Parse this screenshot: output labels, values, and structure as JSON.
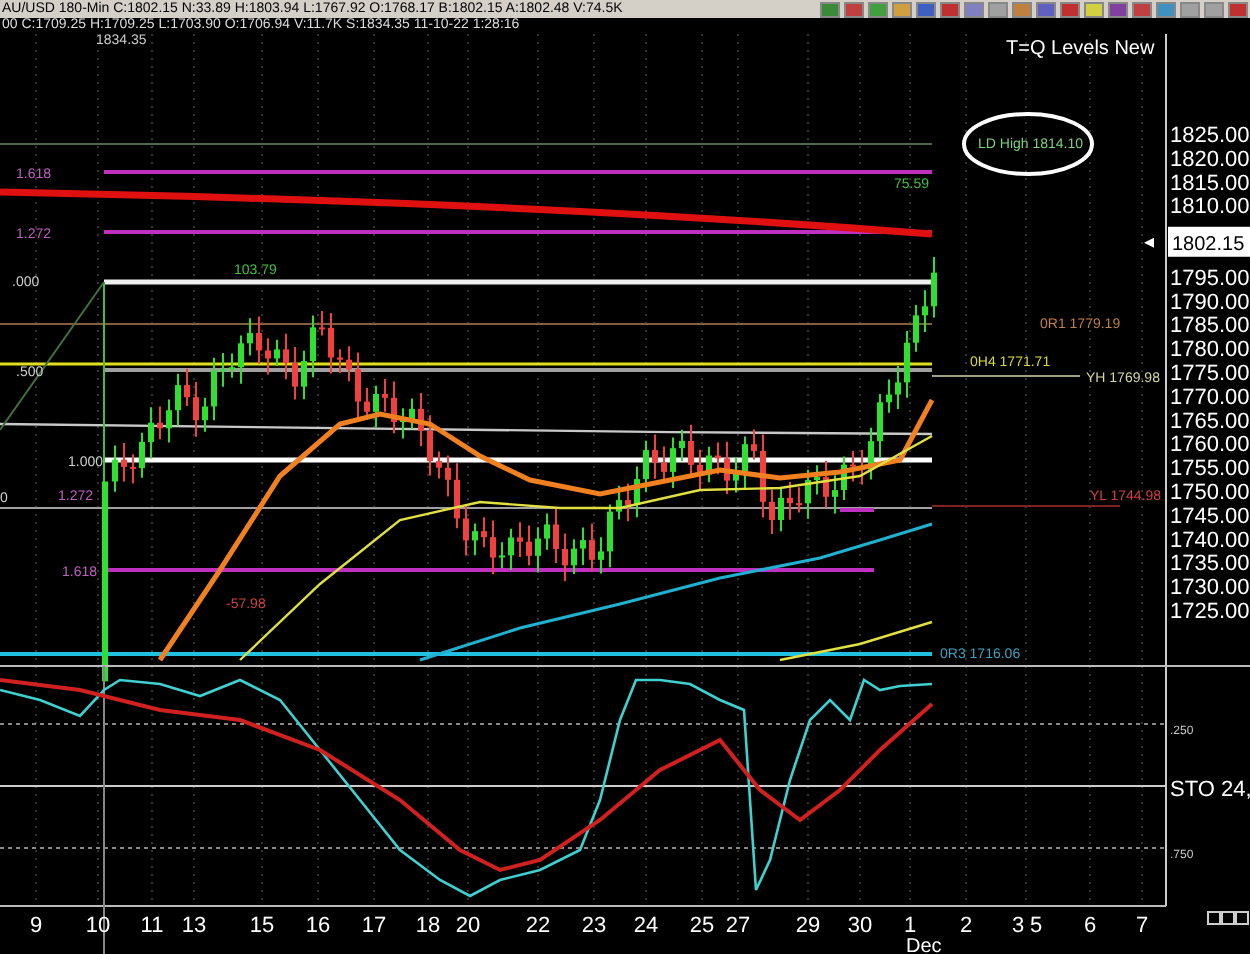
{
  "quote_bar": {
    "text": "AU/USD  180-Min  C:1802.15  N:33.89  H:1803.94  L:1767.92  O:1768.17  B:1802.15  A:1802.48  V:74.5K"
  },
  "cursor_bar": {
    "text": "00  C:1709.25  H:1709.25  L:1703.90  O:1706.94  V:11.7K  S:1834.35  11-10-22  1:28:16"
  },
  "chart": {
    "title": "T=Q Levels New",
    "session_high": "1834.35",
    "annotations": [
      {
        "text": "LD High  1814.10",
        "color": "#7fd07f"
      },
      {
        "text": "1.618",
        "color": "#c060c0"
      },
      {
        "text": "1.272",
        "color": "#c060c0"
      },
      {
        "text": ".000",
        "color": "#d0d0d0"
      },
      {
        "text": "103.79",
        "color": "#40c040"
      },
      {
        "text": ".500",
        "color": "#d0d0d0"
      },
      {
        "text": "1.000",
        "color": "#d0d0d0"
      },
      {
        "text": "0",
        "color": "#d0d0d0"
      },
      {
        "text": "1.272",
        "color": "#c060c0"
      },
      {
        "text": "1.618",
        "color": "#c060c0"
      },
      {
        "text": "-57.98",
        "color": "#d04040"
      },
      {
        "text": "75.59",
        "color": "#40c040"
      },
      {
        "text": "0R1  1779.19",
        "color": "#c08040"
      },
      {
        "text": "0H4  1771.71",
        "color": "#d8d840"
      },
      {
        "text": "YH  1769.98",
        "color": "#d8d8a0"
      },
      {
        "text": "YL  1744.98",
        "color": "#d04040"
      },
      {
        "text": "0R3  1716.06",
        "color": "#40a0c0"
      }
    ],
    "price_axis": [
      "1825.00",
      "1820.00",
      "1815.00",
      "1810.00",
      "1795.00",
      "1790.00",
      "1785.00",
      "1780.00",
      "1775.00",
      "1770.00",
      "1765.00",
      "1760.00",
      "1755.00",
      "1750.00",
      "1745.00",
      "1740.00",
      "1735.00",
      "1730.00",
      "1725.00"
    ],
    "current_price": "1802.15"
  },
  "indicator": {
    "label": "STO  24,",
    "levels": [
      ".250",
      ".750"
    ]
  },
  "time_axis": {
    "labels": [
      "9",
      "10",
      "11",
      "13",
      "15",
      "16",
      "17",
      "18",
      "20",
      "22",
      "23",
      "24",
      "25",
      "27",
      "29",
      "30",
      "1",
      "2",
      "3",
      "5",
      "6",
      "7"
    ],
    "month": "Dec"
  }
}
